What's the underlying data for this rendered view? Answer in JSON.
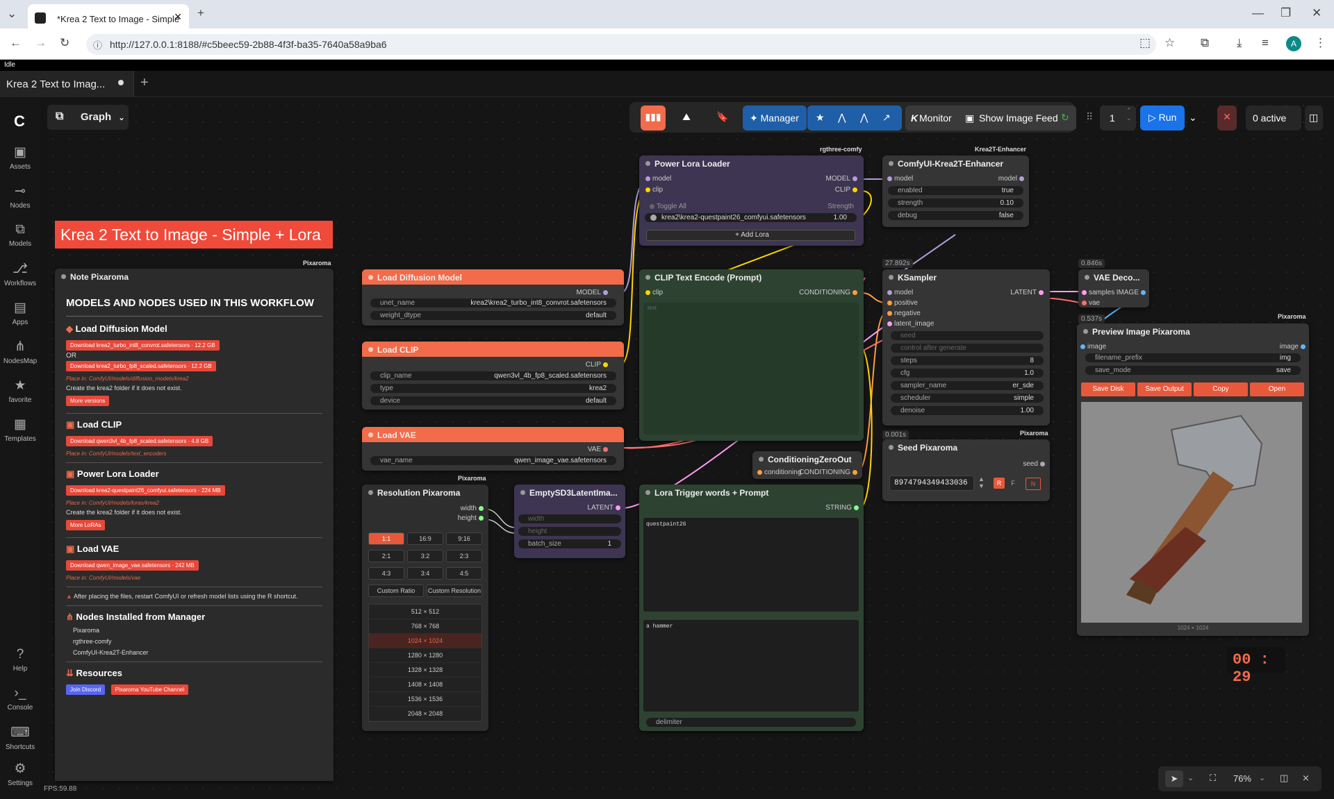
{
  "browser": {
    "tab_title": "*Krea 2 Text to Image - Simple",
    "url": "http://127.0.0.1:8188/#c5beec59-2b88-4f3f-ba35-7640a58a9ba6",
    "profile_initial": "A"
  },
  "status": "Idle",
  "workflow_tab": {
    "label": "Krea 2 Text to Imag..."
  },
  "graph_menu": "Graph",
  "sidebar": {
    "items": [
      {
        "label": "Assets"
      },
      {
        "label": "Nodes"
      },
      {
        "label": "Models"
      },
      {
        "label": "Workflows"
      },
      {
        "label": "Apps"
      },
      {
        "label": "NodesMap"
      },
      {
        "label": "favorite"
      },
      {
        "label": "Templates"
      },
      {
        "label": "Help"
      },
      {
        "label": "Console"
      },
      {
        "label": "Shortcuts"
      },
      {
        "label": "Settings"
      }
    ]
  },
  "toolbar": {
    "manager": "Manager",
    "monitor": "Monitor",
    "monitor_k": "K",
    "show_feed": "Show Image Feed",
    "count": "1",
    "run": "Run",
    "active": "0 active"
  },
  "title_banner": "Krea 2 Text to Image - Simple + Lora",
  "note": {
    "title": "Note Pixaroma",
    "brand": "Pixaroma",
    "heading": "MODELS AND NODES USED IN THIS WORKFLOW",
    "diffusion": {
      "title": "Load Diffusion Model",
      "dl1": "Download krea2_turbo_int8_convrot.safetensors  ·  12.2 GB",
      "or": "OR",
      "dl2": "Download krea2_turbo_fp8_scaled.safetensors  ·  12.2 GB",
      "place": "Place in: ComfyUI/models/diffusion_models/krea2",
      "create": "Create the  krea2  folder if it does not exist.",
      "more": "More versions"
    },
    "clip": {
      "title": "Load CLIP",
      "dl": "Download qwen3vl_4b_fp8_scaled.safetensors  ·  4.8 GB",
      "place": "Place in: ComfyUI/models/text_encoders"
    },
    "lora": {
      "title": "Power Lora Loader",
      "dl": "Download krea2-questpaint26_comfyui.safetensors  ·  224 MB",
      "place": "Place in: ComfyUI/models/loras/krea2",
      "create": "Create the  krea2  folder if it does not exist.",
      "more": "More LoRAs"
    },
    "vae": {
      "title": "Load VAE",
      "dl": "Download qwen_image_vae.safetensors  ·  242 MB",
      "place": "Place in: ComfyUI/models/vae"
    },
    "warning": "After placing the files, restart ComfyUI or refresh model lists using the R shortcut.",
    "nodes_title": "Nodes Installed from Manager",
    "nodes": [
      "Pixaroma",
      "rgthree-comfy",
      "ComfyUI-Krea2T-Enhancer"
    ],
    "resources": "Resources",
    "discord": "Join Discord",
    "youtube": "Pixaroma YouTube Channel"
  },
  "nodes": {
    "load_diffusion": {
      "title": "Load Diffusion Model",
      "out": "MODEL",
      "unet_label": "unet_name",
      "unet": "krea2\\krea2_turbo_int8_convrot.safetensors",
      "dtype_label": "weight_dtype",
      "dtype": "default"
    },
    "load_clip": {
      "title": "Load CLIP",
      "out": "CLIP",
      "clip_label": "clip_name",
      "clip": "qwen3vl_4b_fp8_scaled.safetensors",
      "type_label": "type",
      "type": "krea2",
      "device_label": "device",
      "device": "default"
    },
    "load_vae": {
      "title": "Load VAE",
      "out": "VAE",
      "vae_label": "vae_name",
      "vae": "qwen_image_vae.safetensors"
    },
    "lora_loader": {
      "brand": "rgthree-comfy",
      "title": "Power Lora Loader",
      "in_model": "model",
      "in_clip": "clip",
      "out_model": "MODEL",
      "out_clip": "CLIP",
      "toggle": "Toggle All",
      "strength": "Strength",
      "lora": "krea2\\krea2-questpaint26_comfyui.safetensors",
      "lora_strength": "1.00",
      "add": "Add Lora"
    },
    "enhancer": {
      "brand": "Krea2T-Enhancer",
      "title": "ComfyUI-Krea2T-Enhancer",
      "in": "model",
      "out": "model",
      "enabled_label": "enabled",
      "enabled": "true",
      "strength_label": "strength",
      "strength": "0.10",
      "debug_label": "debug",
      "debug": "false"
    },
    "clip_encode": {
      "title": "CLIP Text Encode (Prompt)",
      "in": "clip",
      "out": "CONDITIONING",
      "text_label": "text"
    },
    "ksampler": {
      "timing": "27.892s",
      "title": "KSampler",
      "out": "LATENT",
      "inputs": [
        "model",
        "positive",
        "negative",
        "latent_image"
      ],
      "seed_label": "seed",
      "control": "control after generate",
      "steps_label": "steps",
      "steps": "8",
      "cfg_label": "cfg",
      "cfg": "1.0",
      "sampler_label": "sampler_name",
      "sampler": "er_sde",
      "scheduler_label": "scheduler",
      "scheduler": "simple",
      "denoise_label": "denoise",
      "denoise": "1.00"
    },
    "vae_decode": {
      "timing": "0.846s",
      "title": "VAE Deco...",
      "in1": "samples",
      "in2": "vae",
      "out": "IMAGE"
    },
    "preview": {
      "timing": "0.537s",
      "brand": "Pixaroma",
      "title": "Preview Image Pixaroma",
      "in": "image",
      "out": "image",
      "prefix_label": "filename_prefix",
      "prefix": "img",
      "mode_label": "save_mode",
      "mode": "save",
      "save_disk": "Save Disk",
      "save_output": "Save Output",
      "copy": "Copy",
      "open": "Open",
      "dims": "1024 × 1024"
    },
    "zero_out": {
      "title": "ConditioningZeroOut",
      "in": "conditioning",
      "out": "CONDITIONING"
    },
    "seed": {
      "timing": "0.001s",
      "brand": "Pixaroma",
      "title": "Seed Pixaroma",
      "out": "seed",
      "value": "8974794349433036",
      "r": "R",
      "f": "F",
      "n": "N"
    },
    "resolution": {
      "brand": "Pixaroma",
      "title": "Resolution Pixaroma",
      "out_w": "width",
      "out_h": "height",
      "ratios": [
        "1:1",
        "16:9",
        "9:16",
        "2:1",
        "3:2",
        "2:3",
        "4:3",
        "3:4",
        "4:5"
      ],
      "custom_ratio": "Custom Ratio",
      "custom_res": "Custom Resolution",
      "sizes": [
        "512 × 512",
        "768 × 768",
        "1024 × 1024",
        "1280 × 1280",
        "1328 × 1328",
        "1408 × 1408",
        "1536 × 1536",
        "2048 × 2048"
      ],
      "selected_size": "1024 × 1024"
    },
    "latent": {
      "title": "EmptySD3LatentIma...",
      "out": "LATENT",
      "width_label": "width",
      "height_label": "height",
      "batch_label": "batch_size",
      "batch": "1"
    },
    "lora_prompt": {
      "title": "Lora Trigger words + Prompt",
      "out": "STRING",
      "trigger": "questpaint26",
      "prompt": "a hammer",
      "delimiter_label": "delimiter"
    }
  },
  "timer": "00 : 29",
  "fps": "FPS:59.88",
  "zoom": "76%",
  "colors": {
    "accent": "#f26b4a",
    "run": "#1a73e8",
    "manager": "#1f5fa8"
  }
}
